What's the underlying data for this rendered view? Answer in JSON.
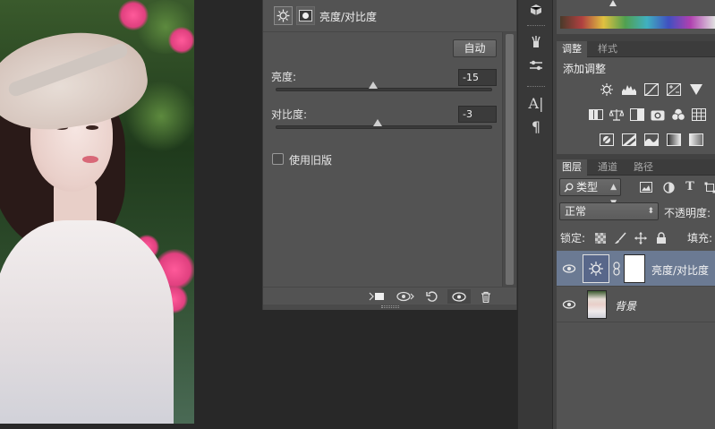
{
  "properties": {
    "title": "亮度/对比度",
    "auto_label": "自动",
    "brightness": {
      "label": "亮度:",
      "value": "-15",
      "level": 0.45
    },
    "contrast": {
      "label": "对比度:",
      "value": "-3",
      "level": 0.47
    },
    "legacy_label": "使用旧版",
    "legacy_checked": false,
    "footer_icons": [
      "clip-to-layer-icon",
      "view-previous-icon",
      "reset-icon",
      "visibility-eye-icon",
      "trash-icon"
    ]
  },
  "adjustments_panel": {
    "tabs": [
      {
        "label": "调整",
        "active": true
      },
      {
        "label": "样式",
        "active": false
      }
    ],
    "title": "添加调整",
    "icons_row1": [
      "brightness-contrast-icon",
      "levels-icon",
      "curves-icon",
      "exposure-icon",
      "vibrance-triangle-icon"
    ],
    "icons_row2": [
      "hue-saturation-icon",
      "color-balance-icon",
      "black-white-icon",
      "photo-filter-icon",
      "channel-mixer-icon",
      "color-lookup-icon"
    ],
    "icons_row3": [
      "invert-icon",
      "posterize-icon",
      "threshold-icon",
      "gradient-map-icon",
      "selective-color-icon"
    ]
  },
  "layers_panel": {
    "tabs": [
      {
        "label": "图层",
        "active": true
      },
      {
        "label": "通道",
        "active": false
      },
      {
        "label": "路径",
        "active": false
      }
    ],
    "filter_label": "类型",
    "blend_mode": "正常",
    "opacity_label": "不透明度:",
    "lock_label": "锁定:",
    "fill_label": "填充:",
    "layers": [
      {
        "name": "亮度/对比度",
        "selected": true
      },
      {
        "name": "背景",
        "selected": false
      }
    ]
  },
  "colors": {
    "panel_bg": "#535353",
    "selected_row": "#6b7a93",
    "workspace": "#282828"
  }
}
